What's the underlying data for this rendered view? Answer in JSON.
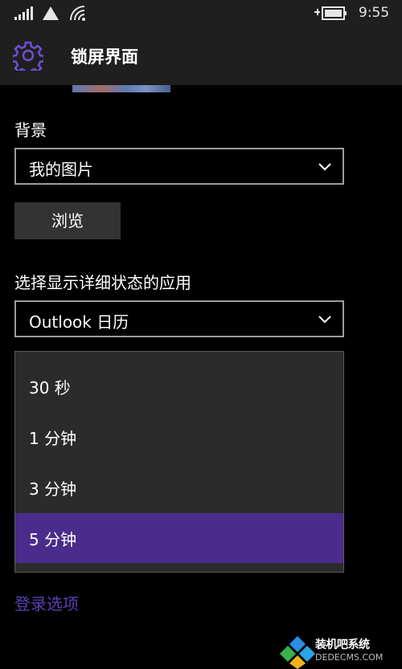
{
  "status_bar": {
    "time": "9:55"
  },
  "header": {
    "title": "锁屏界面"
  },
  "background": {
    "label": "背景",
    "selected": "我的图片",
    "browse_label": "浏览"
  },
  "detailed_status": {
    "label": "选择显示详细状态的应用",
    "selected": "Outlook 日历"
  },
  "timeout_dropdown": {
    "options": [
      "30 秒",
      "1 分钟",
      "3 分钟",
      "5 分钟"
    ],
    "selected_index": 3
  },
  "signin_link": "登录选项",
  "watermark": {
    "line1": "装机吧系统",
    "line2": "DEDECMS.COM"
  },
  "colors": {
    "accent": "#4a2c8c",
    "link": "#5b3fb3",
    "chrome": "#1f1f1f"
  }
}
